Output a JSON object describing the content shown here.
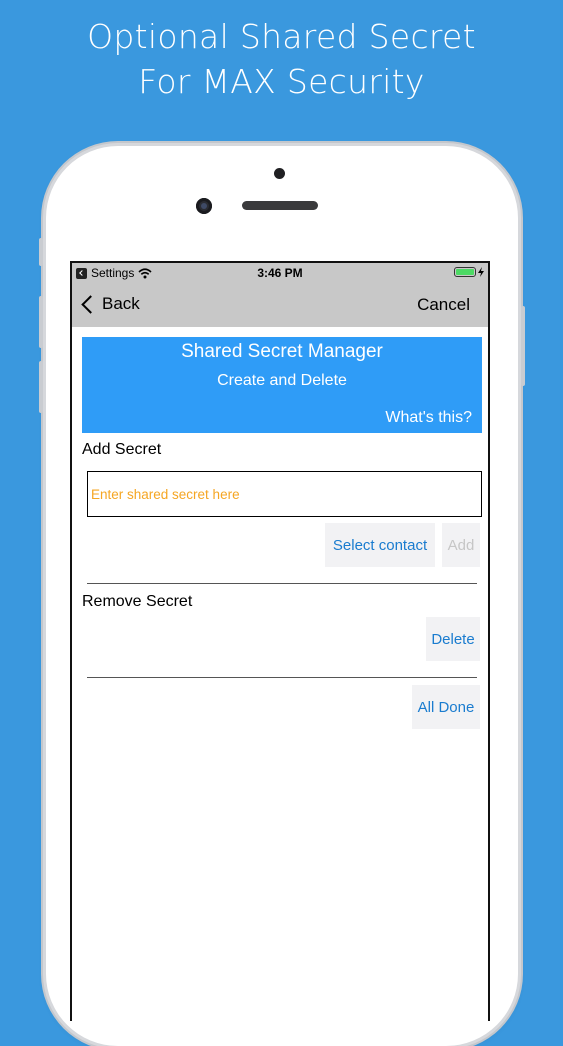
{
  "promo": {
    "headline_line1": "Optional Shared Secret",
    "headline_line2": "For MAX Security"
  },
  "status_bar": {
    "back_app": "Settings",
    "time": "3:46 PM",
    "battery_percent": 100
  },
  "nav": {
    "back_label": "Back",
    "cancel_label": "Cancel"
  },
  "banner": {
    "title": "Shared Secret Manager",
    "subtitle": "Create and Delete",
    "help_link": "What's this?"
  },
  "add_section": {
    "heading": "Add Secret",
    "input_value": "",
    "input_placeholder": "Enter shared secret here",
    "select_contact_label": "Select contact",
    "add_label": "Add"
  },
  "remove_section": {
    "heading": "Remove Secret",
    "delete_label": "Delete"
  },
  "footer": {
    "all_done_label": "All Done"
  },
  "colors": {
    "page_background": "#3a98de",
    "banner": "#2f9cf7",
    "link": "#1a7ccf",
    "placeholder": "#f5a623",
    "nav_bar": "#c8c8c8",
    "battery": "#4cd964"
  }
}
